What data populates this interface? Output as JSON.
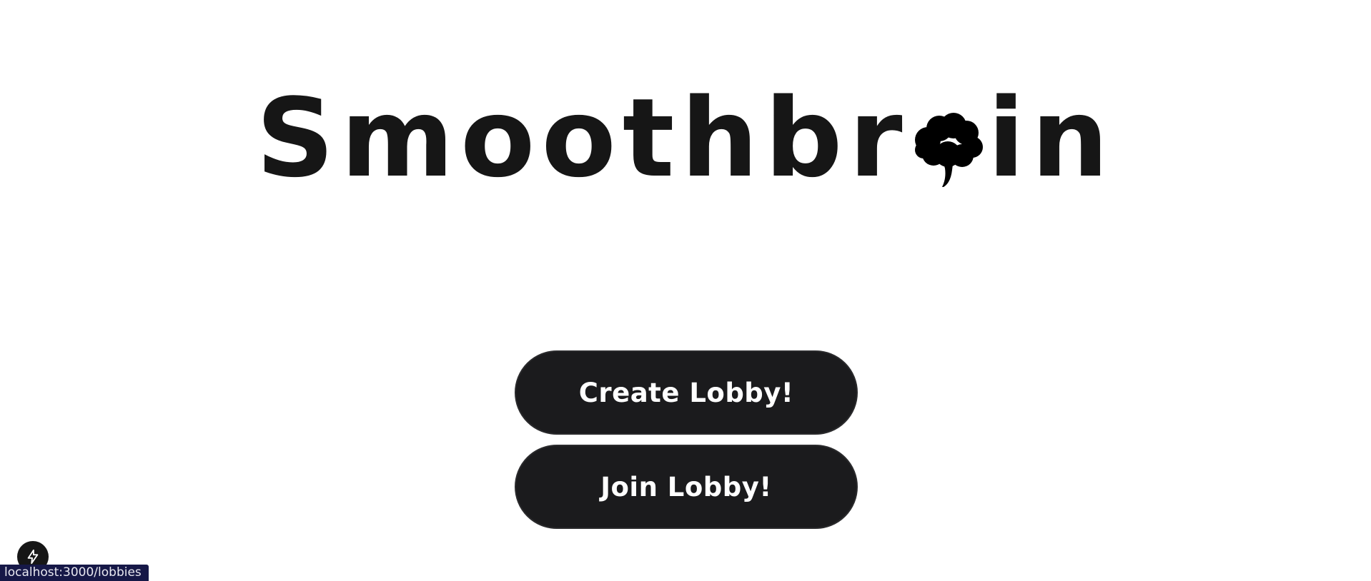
{
  "logo": {
    "text_before": "Smoothbr",
    "text_after": "in",
    "icon": "brain-icon"
  },
  "buttons": {
    "create_label": "Create Lobby!",
    "join_label": "Join Lobby!"
  },
  "dev_indicator": {
    "icon": "lightning-bolt-icon"
  },
  "status_bar": {
    "url": "localhost:3000/lobbies"
  },
  "colors": {
    "background": "#ffffff",
    "text": "#161616",
    "button_bg": "#1b1b1d",
    "button_text": "#ffffff",
    "status_bar_bg": "#161847"
  }
}
